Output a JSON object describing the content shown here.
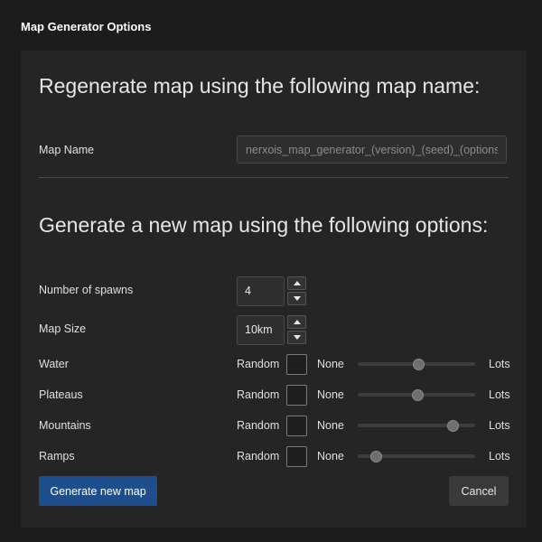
{
  "window": {
    "title": "Map Generator Options"
  },
  "regenerate": {
    "heading": "Regenerate map using the following map name:",
    "map_name_label": "Map Name",
    "map_name_placeholder": "nerxois_map_generator_(version)_(seed)_(options)"
  },
  "generate": {
    "heading": "Generate a new map using the following options:",
    "spawns": {
      "label": "Number of spawns",
      "value": "4"
    },
    "map_size": {
      "label": "Map Size",
      "value": "10km"
    },
    "option_labels": {
      "random": "Random",
      "none": "None",
      "lots": "Lots"
    },
    "terrain": [
      {
        "label": "Water",
        "random_checked": false,
        "level": 0.52
      },
      {
        "label": "Plateaus",
        "random_checked": false,
        "level": 0.51
      },
      {
        "label": "Mountains",
        "random_checked": false,
        "level": 0.85
      },
      {
        "label": "Ramps",
        "random_checked": false,
        "level": 0.12
      }
    ]
  },
  "buttons": {
    "generate": "Generate new map",
    "cancel": "Cancel"
  },
  "colors": {
    "background": "#1c1c1c",
    "panel": "#252526",
    "primary_button": "#1f4e8c",
    "secondary_button": "#3a3a3a"
  }
}
